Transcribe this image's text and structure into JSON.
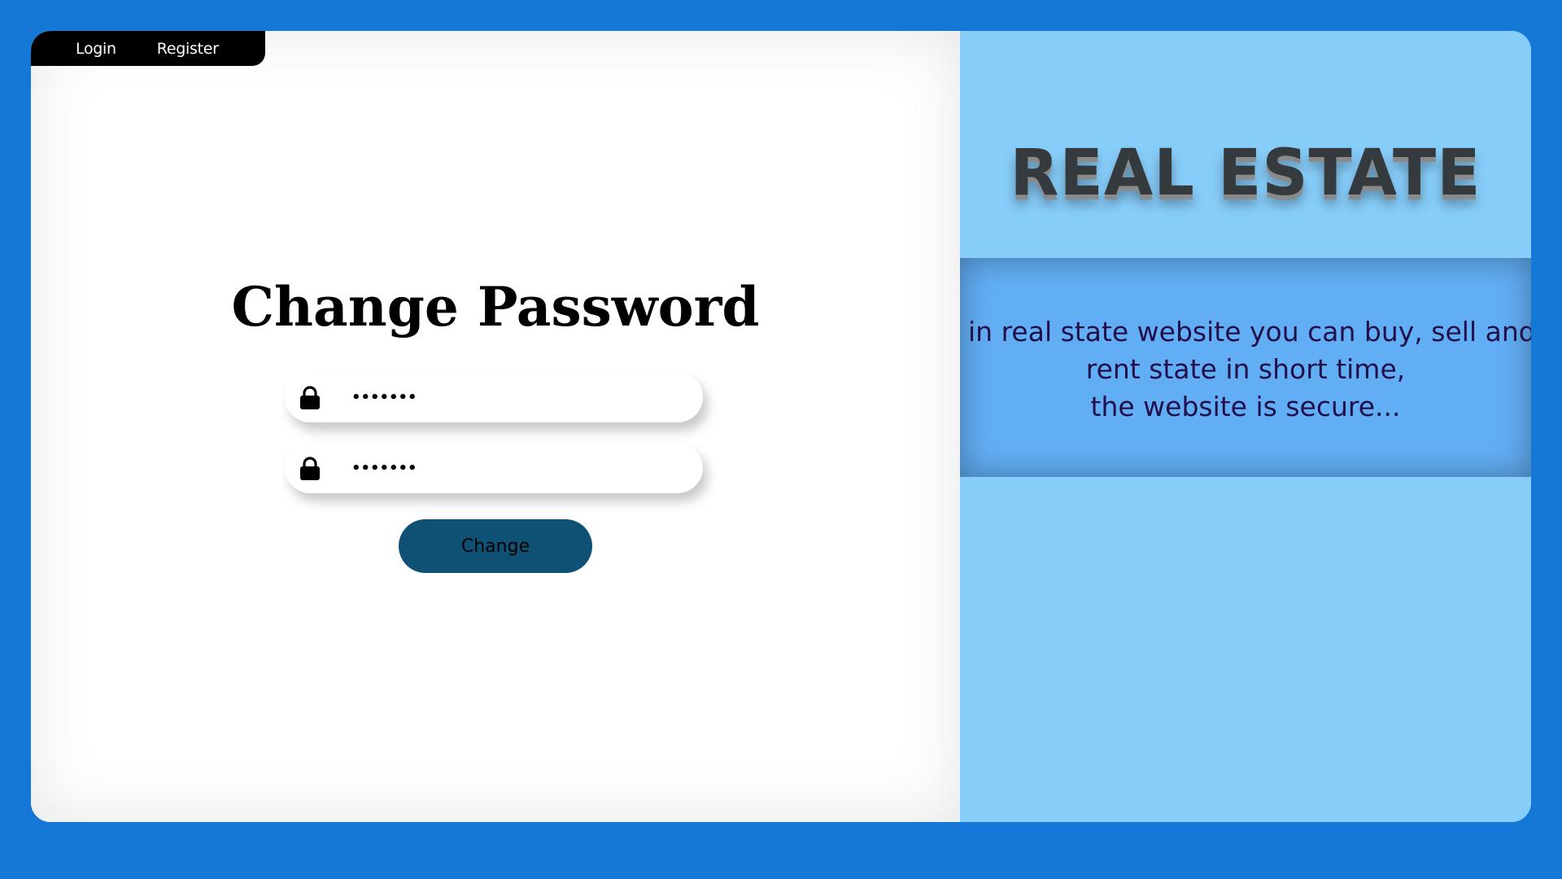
{
  "nav": {
    "login_label": "Login",
    "register_label": "Register"
  },
  "form": {
    "title": "Change Password",
    "password_field_1": {
      "value": "•••••••",
      "icon": "lock-icon"
    },
    "password_field_2": {
      "value": "•••••••",
      "icon": "lock-icon"
    },
    "change_button_label": "Change"
  },
  "brand": {
    "title": "REAL ESTATE",
    "description_lines": [
      "in real state website you can buy, sell and",
      "rent state in short time,",
      "the website is secure..."
    ]
  },
  "colors": {
    "background": "#1578d6",
    "right_panel": "#87cdfa",
    "description_box": "#62aef5",
    "button": "#0f5175",
    "nav": "#000000"
  }
}
